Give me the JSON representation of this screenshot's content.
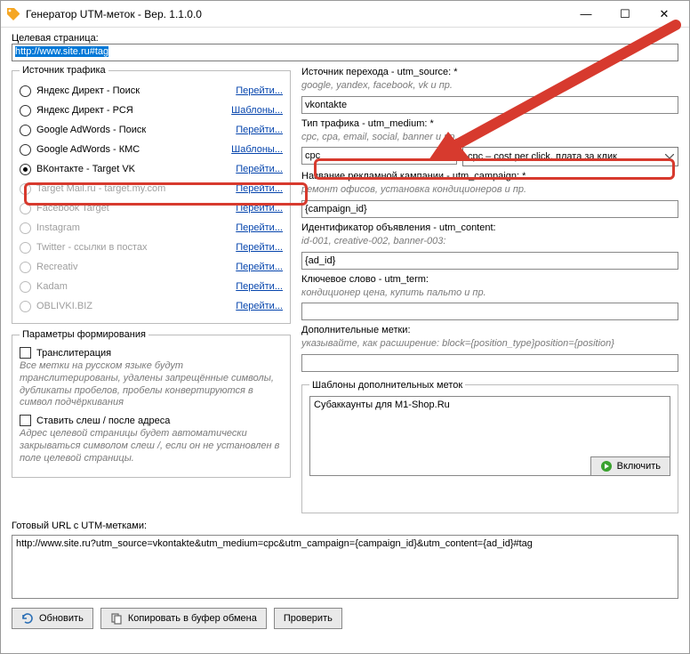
{
  "window": {
    "title": "Генератор UTM-меток - Вер. 1.1.0.0"
  },
  "target": {
    "label": "Целевая страница:",
    "value": "http://www.site.ru#tag"
  },
  "sources": {
    "legend": "Источник трафика",
    "items": [
      {
        "label": "Яндекс Директ - Поиск",
        "action": "Перейти...",
        "enabled": true,
        "checked": false
      },
      {
        "label": "Яндекс Директ - РСЯ",
        "action": "Шаблоны...",
        "enabled": true,
        "checked": false
      },
      {
        "label": "Google AdWords - Поиск",
        "action": "Перейти...",
        "enabled": true,
        "checked": false
      },
      {
        "label": "Google AdWords - КМС",
        "action": "Шаблоны...",
        "enabled": true,
        "checked": false
      },
      {
        "label": "ВКонтакте - Target VK",
        "action": "Перейти...",
        "enabled": true,
        "checked": true
      },
      {
        "label": "Target Mail.ru - target.my.com",
        "action": "Перейти...",
        "enabled": false,
        "checked": false
      },
      {
        "label": "Facebook Target",
        "action": "Перейти...",
        "enabled": false,
        "checked": false
      },
      {
        "label": "Instagram",
        "action": "Перейти...",
        "enabled": false,
        "checked": false
      },
      {
        "label": "Twitter - ссылки в постах",
        "action": "Перейти...",
        "enabled": false,
        "checked": false
      },
      {
        "label": "Recreativ",
        "action": "Перейти...",
        "enabled": false,
        "checked": false
      },
      {
        "label": "Kadam",
        "action": "Перейти...",
        "enabled": false,
        "checked": false
      },
      {
        "label": "OBLIVKI.BIZ",
        "action": "Перейти...",
        "enabled": false,
        "checked": false
      }
    ]
  },
  "params": {
    "legend": "Параметры формирования",
    "translit_label": "Транслитерация",
    "translit_hint": "Все метки на русском языке будут транслитерированы, удалены запрещённые символы, дубликаты пробелов, пробелы конвертируются в символ подчёркивания",
    "slash_label": "Ставить слеш / после адреса",
    "slash_hint": "Адрес целевой страницы будет автоматически закрываться символом слеш /, если он не установлен в поле целевой страницы."
  },
  "utm": {
    "source_label": "Источник перехода - utm_source: *",
    "source_hint": "google, yandex, facebook, vk и пр.",
    "source_value": "vkontakte",
    "medium_label": "Тип трафика - utm_medium: *",
    "medium_hint": "cpc, cpa, email, social, banner и пр.",
    "medium_value": "cpc",
    "medium_select": "cpc – cost per click, плата за клик",
    "campaign_label": "Название рекламной кампании - utm_campaign: *",
    "campaign_hint": "ремонт офисов, установка кондиционеров и пр.",
    "campaign_value": "{campaign_id}",
    "content_label": "Идентификатор объявления - utm_content:",
    "content_hint": "id-001, creative-002, banner-003:",
    "content_value": "{ad_id}",
    "term_label": "Ключевое слово - utm_term:",
    "term_hint": "кондиционер цена, купить пальто и пр.",
    "term_value": "",
    "extra_label": "Дополнительные метки:",
    "extra_hint": "указывайте, как расширение: block={position_type}position={position}",
    "extra_value": ""
  },
  "templates": {
    "legend": "Шаблоны дополнительных меток",
    "item": "Субаккаунты для M1-Shop.Ru",
    "enable_btn": "Включить"
  },
  "result": {
    "label": "Готовый URL с UTM-метками:",
    "value": "http://www.site.ru?utm_source=vkontakte&utm_medium=cpc&utm_campaign={campaign_id}&utm_content={ad_id}#tag"
  },
  "buttons": {
    "refresh": "Обновить",
    "copy": "Копировать в буфер обмена",
    "check": "Проверить"
  }
}
